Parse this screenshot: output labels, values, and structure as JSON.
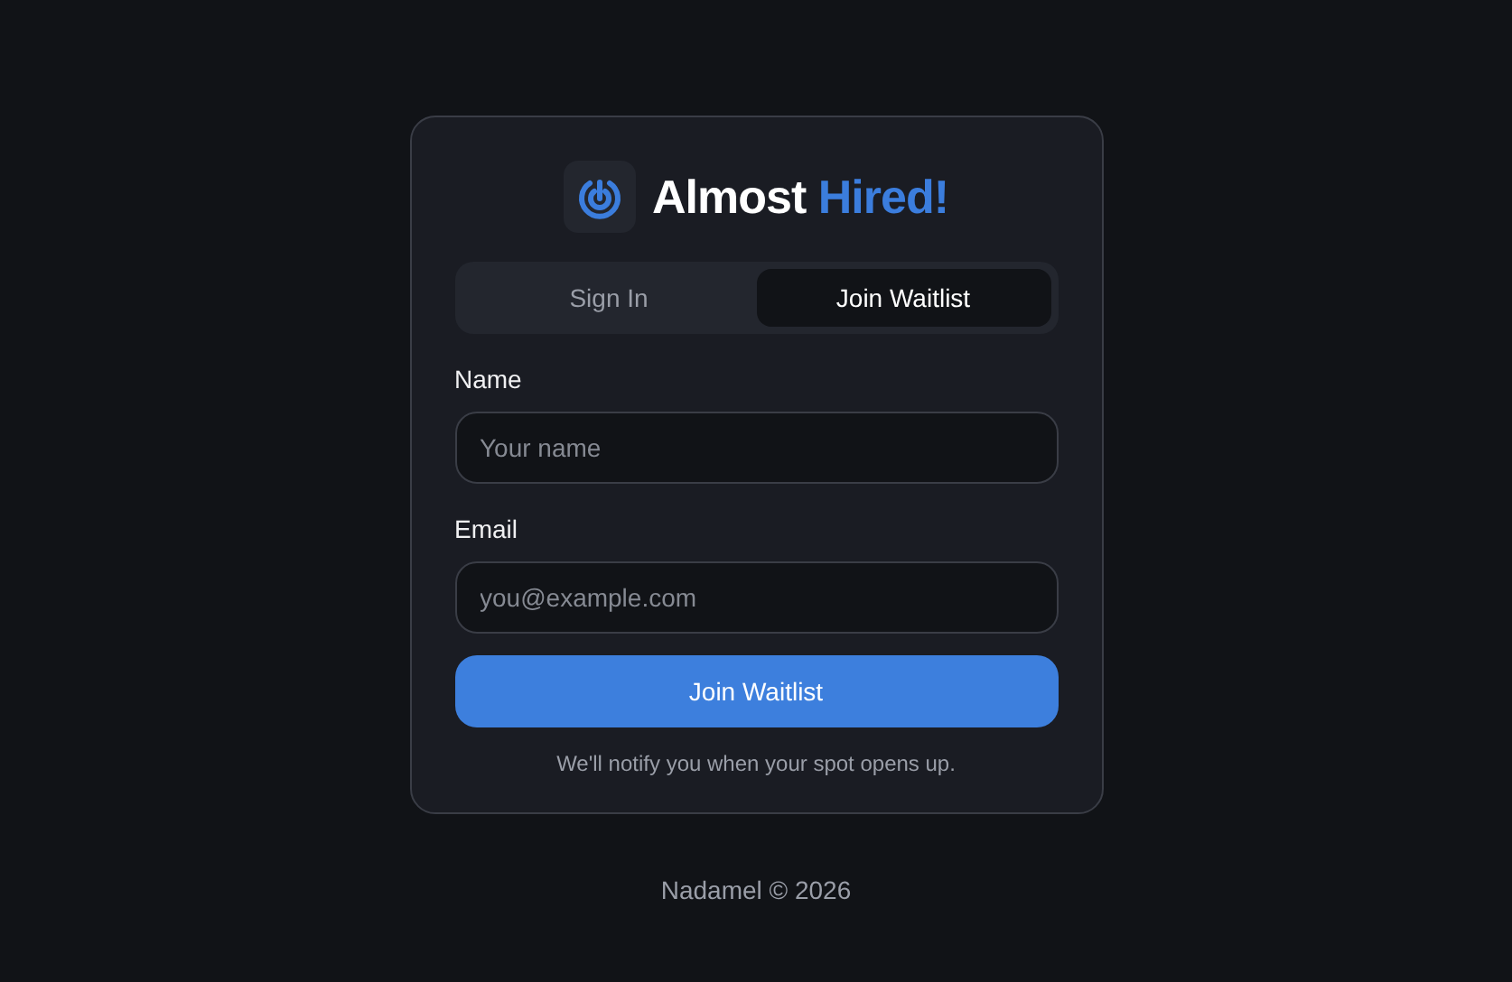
{
  "brand": {
    "name": "Almost",
    "accent": "Hired!"
  },
  "tabs": [
    {
      "label": "Sign In",
      "selected": false
    },
    {
      "label": "Join Waitlist",
      "selected": true
    }
  ],
  "fields": [
    {
      "label": "Name",
      "placeholder": "Your name"
    },
    {
      "label": "Email",
      "placeholder": "you@example.com"
    }
  ],
  "submit": "Join Waitlist",
  "note": "We'll notify you when your spot opens up.",
  "footer": "Nadamel © 2026"
}
